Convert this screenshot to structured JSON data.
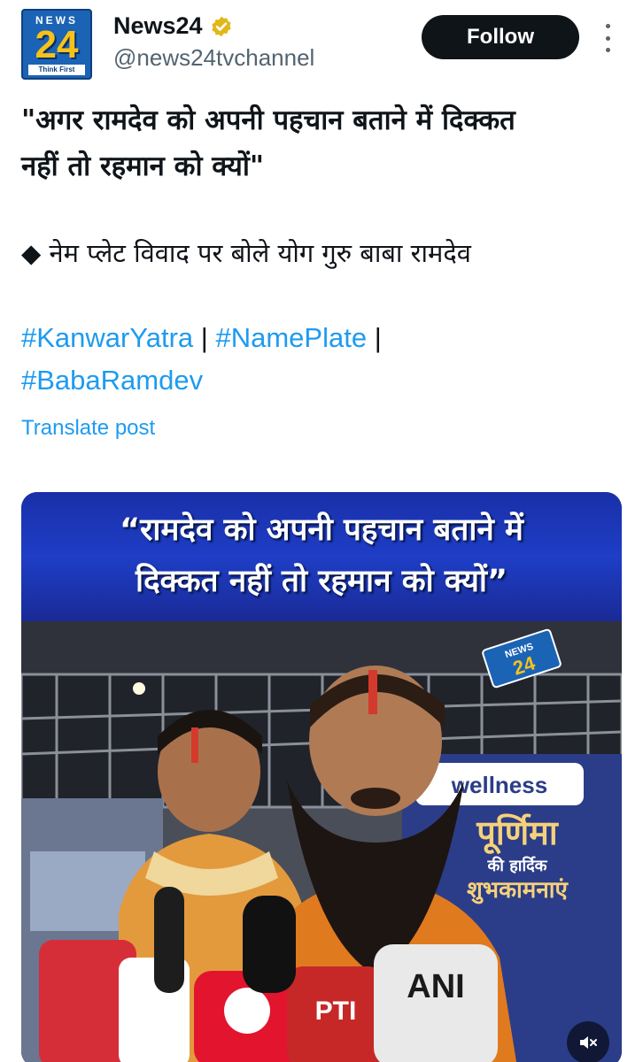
{
  "account": {
    "avatar": {
      "top_text": "NEWS",
      "number": "24",
      "tagline": "Think First"
    },
    "name": "News24",
    "handle": "@news24tvchannel",
    "verified_icon": "verified-badge-icon",
    "follow_label": "Follow",
    "more_icon": "more-vertical-icon"
  },
  "post": {
    "headline_line1": "\"अगर रामदेव को अपनी पहचान बताने में दिक्कत",
    "headline_line2": "नहीं तो रहमान को क्यों\"",
    "bullet": "◆ नेम प्लेट विवाद पर बोले योग गुरु बाबा रामदेव",
    "hashtags": [
      "#KanwarYatra",
      "#NamePlate",
      "#BabaRamdev"
    ],
    "separator": "|",
    "translate_label": "Translate post"
  },
  "media": {
    "banner_line1": "“रामदेव को अपनी पहचान बताने में",
    "banner_line2": "दिक्कत नहीं तो रहमान को क्यों”",
    "watermark": "NEWS 24",
    "poster_brand": "wellness",
    "poster_line1": "पूर्णिमा",
    "poster_line2": "की हार्दिक",
    "poster_line3": "शुभकामनाएं",
    "mic_label_1": "PTI",
    "mic_label_2": "ANI",
    "mute_icon": "volume-muted-icon"
  },
  "colors": {
    "accent": "#1d9bf0",
    "text": "#0f1419",
    "muted": "#536471",
    "banner": "#1e3ec6"
  }
}
